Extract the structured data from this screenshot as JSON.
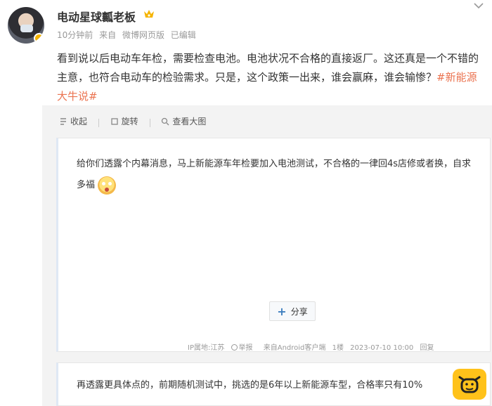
{
  "post": {
    "username": "电动星球瓤老板",
    "time": "10分钟前",
    "source_prefix": "来自",
    "source": "微博网页版",
    "edited": "已编辑",
    "text_main": "看到说以后电动车年检，需要检查电池。电池状况不合格的直接返厂。这还真是一个不错的主意，也符合电动车的检验需求。只是，这个政策一出来，谁会赢麻，谁会输惨？",
    "hashtag": "#新能源大牛说#"
  },
  "screenshot": {
    "toolbar": {
      "collect": "收起",
      "rotate": "旋转",
      "view_large": "查看大图"
    },
    "quote": {
      "text": "给你们透露个内幕消息，马上新能源车年检要加入电池测试，不合格的一律回4s店修或者换，自求多福"
    },
    "share_label": "分享",
    "footer": {
      "ip": "IP属地:江苏",
      "report": "举报",
      "client": "来自Android客户端",
      "floor": "1楼",
      "datetime": "2023-07-10 10:00",
      "reply": "回复"
    },
    "quote2": {
      "text": "再透露更具体点的，前期随机测试中，挑选的是6年以上新能源车型，合格率只有10%"
    }
  },
  "colors": {
    "hashtag": "#eb7350",
    "watermark": "#ffc21a",
    "meta": "#999999"
  },
  "icons": {
    "crown": "crown-icon",
    "more": "chevron-down-icon",
    "collect": "collapse-icon",
    "rotate": "rotate-icon",
    "view_large": "zoom-icon",
    "watermark": "cow-logo-icon"
  }
}
